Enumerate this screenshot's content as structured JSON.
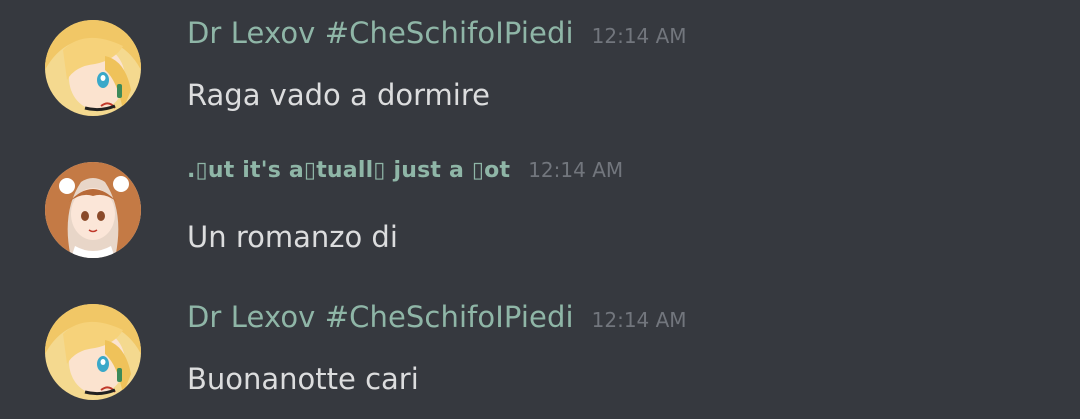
{
  "messages": [
    {
      "username": "Dr Lexov #CheSchifoIPiedi",
      "timestamp": "12:14 AM",
      "text": "Raga vado a dormire",
      "avatar_icon": "blonde-anime-girl-avatar"
    },
    {
      "username": ".▯ut it's a▯tuall▯ just a ▯ot",
      "timestamp": "12:14 AM",
      "text": "Un romanzo di",
      "avatar_icon": "redhead-anime-girl-avatar"
    },
    {
      "username": "Dr Lexov #CheSchifoIPiedi",
      "timestamp": "12:14 AM",
      "text": "Buonanotte cari",
      "avatar_icon": "blonde-anime-girl-avatar"
    }
  ],
  "colors": {
    "background": "#36393f",
    "username": "#8fb6a7",
    "timestamp": "#72767d",
    "message_text": "#dcddde"
  }
}
